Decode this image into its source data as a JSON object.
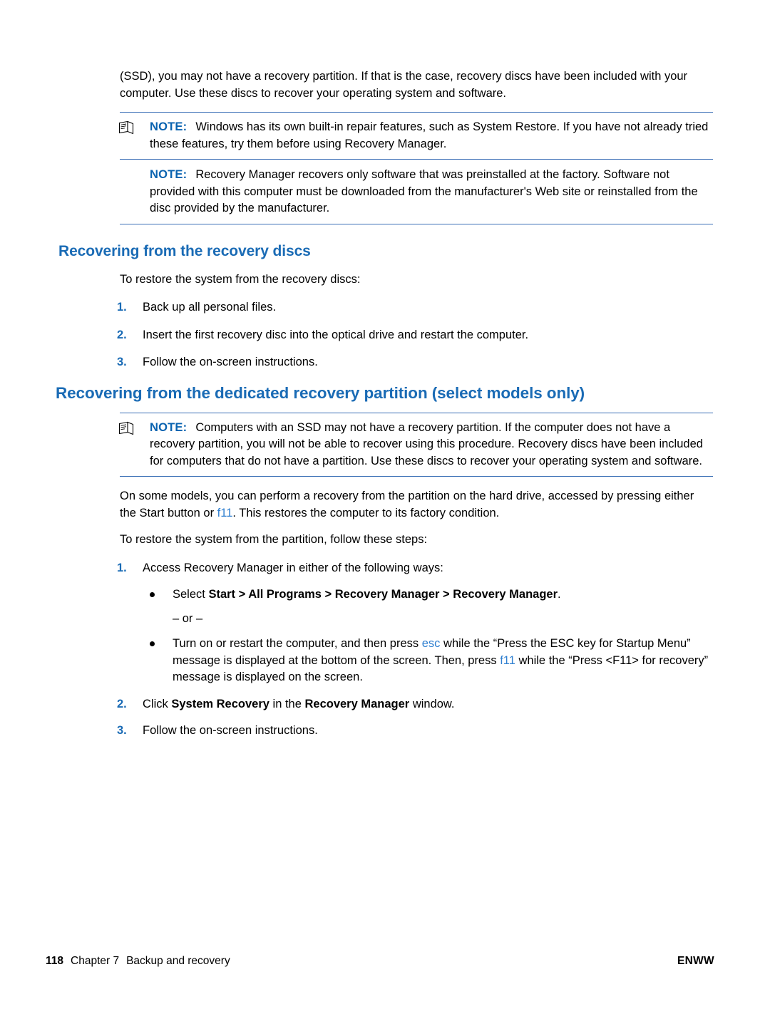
{
  "doc": {
    "intro_paragraph": "(SSD), you may not have a recovery partition. If that is the case, recovery discs have been included with your computer. Use these discs to recover your operating system and software.",
    "note1": {
      "label": "NOTE:",
      "text": "Windows has its own built-in repair features, such as System Restore. If you have not already tried these features, try them before using Recovery Manager."
    },
    "note2": {
      "label": "NOTE:",
      "text": "Recovery Manager recovers only software that was preinstalled at the factory. Software not provided with this computer must be downloaded from the manufacturer's Web site or reinstalled from the disc provided by the manufacturer."
    },
    "section1": {
      "heading": "Recovering from the recovery discs",
      "lead": "To restore the system from the recovery discs:",
      "steps": [
        {
          "num": "1.",
          "text": "Back up all personal files."
        },
        {
          "num": "2.",
          "text": "Insert the first recovery disc into the optical drive and restart the computer."
        },
        {
          "num": "3.",
          "text": "Follow the on-screen instructions."
        }
      ]
    },
    "section2": {
      "heading": "Recovering from the dedicated recovery partition (select models only)",
      "note": {
        "label": "NOTE:",
        "text": "Computers with an SSD may not have a recovery partition. If the computer does not have a recovery partition, you will not be able to recover using this procedure. Recovery discs have been included for computers that do not have a partition. Use these discs to recover your operating system and software."
      },
      "para_a1": "On some models, you can perform a recovery from the partition on the hard drive, accessed by pressing either the Start button or ",
      "para_a_key": "f11",
      "para_a2": ". This restores the computer to its factory condition.",
      "para_b": "To restore the system from the partition, follow these steps:",
      "step1": {
        "num": "1.",
        "text": "Access Recovery Manager in either of the following ways:"
      },
      "bullet1": {
        "prefix": "Select ",
        "bold": "Start > All Programs > Recovery Manager > Recovery Manager",
        "suffix": "."
      },
      "or_label": "– or –",
      "bullet2": {
        "t1": "Turn on or restart the computer, and then press ",
        "key1": "esc",
        "t2": " while the “Press the ESC key for Startup Menu” message is displayed at the bottom of the screen. Then, press ",
        "key2": "f11",
        "t3": " while the “Press <F11> for recovery” message is displayed on the screen."
      },
      "step2": {
        "num": "2.",
        "t1": "Click ",
        "b1": "System Recovery",
        "t2": " in the ",
        "b2": "Recovery Manager",
        "t3": " window."
      },
      "step3": {
        "num": "3.",
        "text": "Follow the on-screen instructions."
      }
    },
    "footer": {
      "page_number": "118",
      "chapter": "Chapter 7",
      "chapter_title": "Backup and recovery",
      "locale": "ENWW"
    },
    "colors": {
      "heading_blue": "#1a6bb5",
      "note_blue": "#0a63b0",
      "rule_blue": "#3b6fb6",
      "key_blue": "#2f7fd0"
    }
  }
}
